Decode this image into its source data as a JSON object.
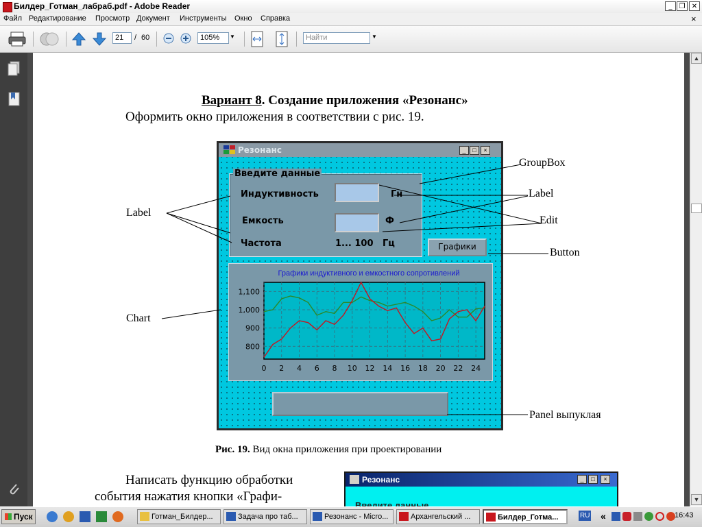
{
  "window": {
    "title": "Билдер_Готман_лабраб.pdf - Adobe Reader",
    "controls": {
      "minimize": "_",
      "maximize": "❐",
      "close": "✕"
    }
  },
  "menu": {
    "items": [
      "Файл",
      "Редактирование",
      "Просмотр",
      "Документ",
      "Инструменты",
      "Окно",
      "Справка"
    ],
    "close": "×"
  },
  "toolbar": {
    "page_current": "21",
    "page_separator": "/",
    "page_total": "60",
    "zoom": "105%",
    "search_placeholder": "Найти"
  },
  "document": {
    "variant_label": "Вариант 8",
    "heading_rest": ". Создание приложения «Резонанс»",
    "instruction": "Оформить окно приложения в соответствии с рис. 19.",
    "caption_bold": "Рис. 19.",
    "caption_rest": " Вид окна приложения при проектировании",
    "paragraph_line1": "Написать функцию обработки",
    "paragraph_line2": "события нажатия кнопки «Графи-"
  },
  "figure": {
    "window_title": "Резонанс",
    "groupbox_title": "Введите данные",
    "label_inductance": "Индуктивность",
    "unit_inductance": "Гн",
    "label_capacitance": "Емкость",
    "unit_capacitance": "Ф",
    "label_frequency": "Частота",
    "frequency_range": "1... 100",
    "unit_frequency": "Гц",
    "button_graphs": "Графики",
    "annotations": {
      "groupbox": "GroupBox",
      "label_left": "Label",
      "label_right": "Label",
      "edit": "Edit",
      "button": "Button",
      "chart": "Chart",
      "panel": "Panel выпуклая"
    }
  },
  "chart_data": {
    "type": "line",
    "title": "Графики индуктивного и емкостного сопротивлений",
    "xlabel": "",
    "ylabel": "",
    "xlim": [
      0,
      25
    ],
    "ylim": [
      730,
      1150
    ],
    "xticks": [
      0,
      2,
      4,
      6,
      8,
      10,
      12,
      14,
      16,
      18,
      20,
      22,
      24
    ],
    "yticks": [
      800,
      900,
      1000,
      1100
    ],
    "ytick_labels": [
      "800",
      "900",
      "1,000",
      "1,100"
    ],
    "grid": true,
    "series": [
      {
        "color": "#2a8a2a",
        "x": [
          0,
          1,
          2,
          3,
          4,
          5,
          6,
          7,
          8,
          9,
          10,
          11,
          12,
          13,
          14,
          15,
          16,
          17,
          18,
          19,
          20,
          21,
          22,
          23,
          24,
          25
        ],
        "y": [
          990,
          1000,
          1060,
          1075,
          1065,
          1040,
          970,
          990,
          980,
          1040,
          1040,
          1070,
          1050,
          1040,
          1020,
          1030,
          1040,
          1020,
          990,
          940,
          955,
          1000,
          960,
          960,
          1005,
          1010
        ]
      },
      {
        "color": "#c8141e",
        "x": [
          0,
          1,
          2,
          3,
          4,
          5,
          6,
          7,
          8,
          9,
          10,
          11,
          12,
          13,
          14,
          15,
          16,
          17,
          18,
          19,
          20,
          21,
          22,
          23,
          24,
          25
        ],
        "y": [
          740,
          810,
          840,
          900,
          940,
          930,
          890,
          940,
          920,
          970,
          1050,
          1150,
          1060,
          1020,
          995,
          1010,
          930,
          870,
          900,
          830,
          840,
          950,
          990,
          1000,
          940,
          1020
        ]
      }
    ],
    "background": "#00b8c8"
  },
  "sidebar": {
    "icons": [
      "pages-icon",
      "bookmarks-icon",
      "attachment-icon"
    ]
  },
  "taskbar": {
    "start": "Пуск",
    "tasks": [
      {
        "label": "Готман_Билдер...",
        "active": false
      },
      {
        "label": "Задача про таб...",
        "active": false
      },
      {
        "label": "Резонанс - Micro...",
        "active": false
      },
      {
        "label": "Архангельский ...",
        "active": false
      },
      {
        "label": "Билдер_Готма...",
        "active": true
      }
    ],
    "language": "RU",
    "clock": "16:43",
    "tray_chevron": "«"
  },
  "second_figure": {
    "title": "Резонанс",
    "partial_text": "Введите данные"
  }
}
